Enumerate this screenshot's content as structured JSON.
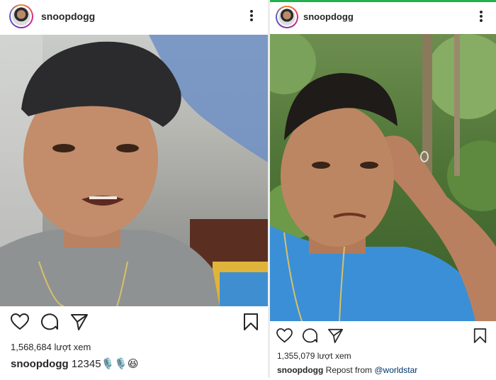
{
  "posts": [
    {
      "username": "snoopdogg",
      "views": "1,568,684 lượt xem",
      "caption_user": "snoopdogg",
      "caption_text": "12345🎙️🎙️😆"
    },
    {
      "username": "snoopdogg",
      "views": "1,355,079 lượt xem",
      "caption_user": "snoopdogg",
      "caption_text": "Repost from ",
      "caption_mention": "@worldstar"
    }
  ],
  "icons": {
    "avatar": "avatar",
    "more": "more-vertical-icon",
    "like": "heart-icon",
    "comment": "comment-bubble-icon",
    "share": "paper-plane-icon",
    "save": "bookmark-icon"
  },
  "colors": {
    "text": "#262626",
    "mention": "#003569",
    "top_bar_accent": "#22b14c"
  }
}
